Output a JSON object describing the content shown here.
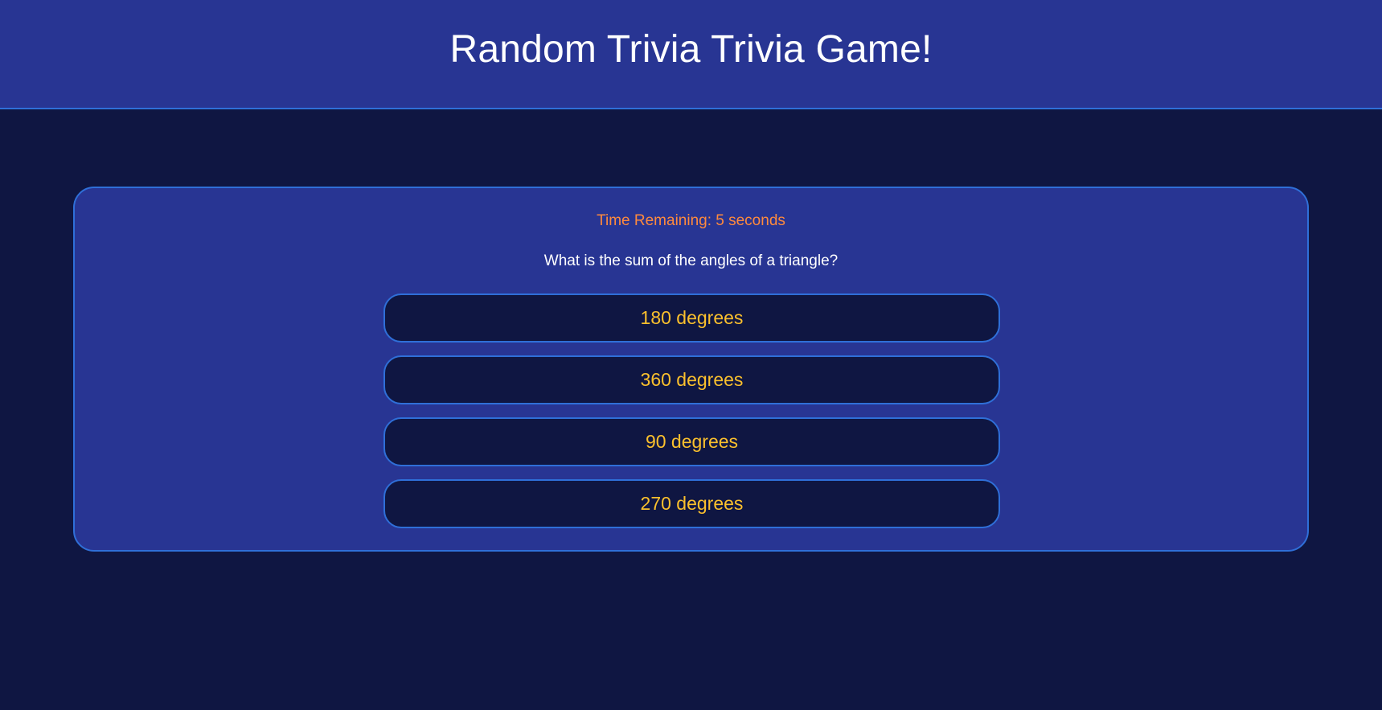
{
  "header": {
    "title": "Random Trivia Trivia Game!"
  },
  "quiz": {
    "timer_text": "Time Remaining: 5 seconds",
    "question": "What is the sum of the angles of a triangle?",
    "answers": [
      "180 degrees",
      "360 degrees",
      "90 degrees",
      "270 degrees"
    ]
  },
  "colors": {
    "background": "#0f1642",
    "panel": "#283593",
    "border": "#2f6fd8",
    "timer": "#ff8a3d",
    "answer_text": "#fbc02d"
  }
}
